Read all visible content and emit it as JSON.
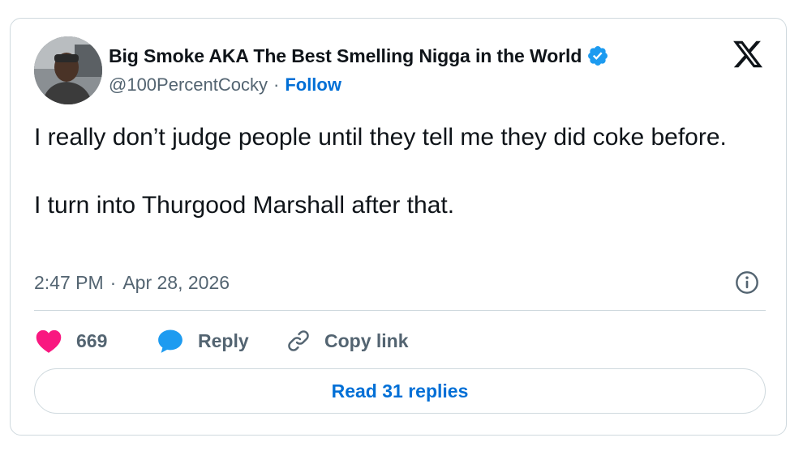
{
  "author": {
    "display_name": "Big Smoke AKA The Best Smelling Nigga in the World",
    "handle": "@100PercentCocky",
    "separator": "·",
    "follow_label": "Follow",
    "verified": true
  },
  "tweet": {
    "text": "I really don’t judge people until they tell me they did coke before.\n\nI turn into Thurgood Marshall after that.",
    "time": "2:47 PM",
    "separator": "·",
    "date": "Apr 28, 2026"
  },
  "actions": {
    "like_count": "669",
    "reply_label": "Reply",
    "copy_label": "Copy link"
  },
  "read_replies_label": "Read 31 replies",
  "icons": {
    "logo": "x-logo-icon",
    "verified": "verified-badge-icon",
    "info": "info-icon",
    "like": "heart-icon",
    "reply": "speech-bubble-icon",
    "copy": "link-icon"
  },
  "colors": {
    "link_blue": "#006fd6",
    "verified_blue": "#1d9bf0",
    "like_red": "#f91880",
    "secondary_text": "#536471",
    "border": "#cfd9de"
  }
}
